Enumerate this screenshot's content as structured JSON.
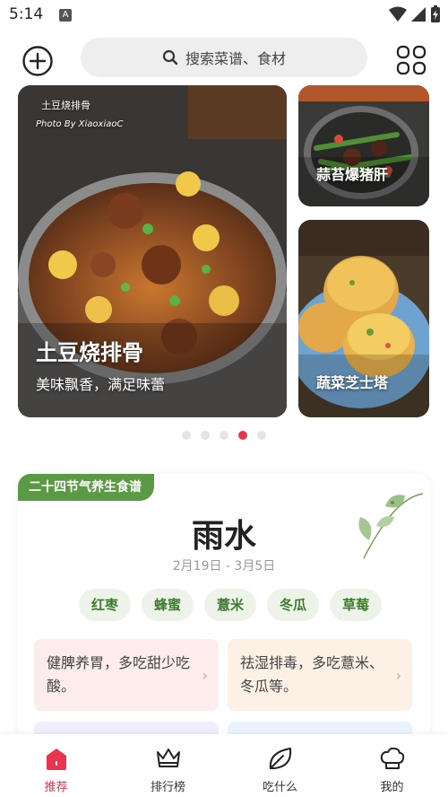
{
  "status_bar": {
    "time": "5:14",
    "notification_glyph": "A"
  },
  "search": {
    "placeholder": "搜索菜谱、食材"
  },
  "banner": {
    "main": {
      "title": "土豆烧排骨",
      "subtitle": "美味飘香，满足味蕾",
      "photo_caption": "土豆烧排骨",
      "photo_credit": "Photo By XiaoxiaoC"
    },
    "side_top": {
      "title": "蒜苔爆猪肝"
    },
    "side_bottom": {
      "title": "蔬菜芝士塔"
    },
    "page_count": 5,
    "active_page": 4
  },
  "solar_term": {
    "tag": "二十四节气养生食谱",
    "name": "雨水",
    "date_range": "2月19日 - 3月5日",
    "foods": [
      "红枣",
      "蜂蜜",
      "薏米",
      "冬瓜",
      "草莓"
    ],
    "tips": [
      {
        "text": "健脾养胃，多吃甜少吃酸。"
      },
      {
        "text": "祛湿排毒，多吃薏米、冬瓜等。"
      }
    ]
  },
  "nav": {
    "items": [
      {
        "label": "推荐",
        "icon": "home-icon"
      },
      {
        "label": "排行榜",
        "icon": "crown-icon"
      },
      {
        "label": "吃什么",
        "icon": "leaf-icon"
      },
      {
        "label": "我的",
        "icon": "chef-hat-icon"
      }
    ]
  },
  "colors": {
    "accent": "#e8344e",
    "tag_green": "#5b9a44",
    "chip_text": "#3e7a2e"
  }
}
